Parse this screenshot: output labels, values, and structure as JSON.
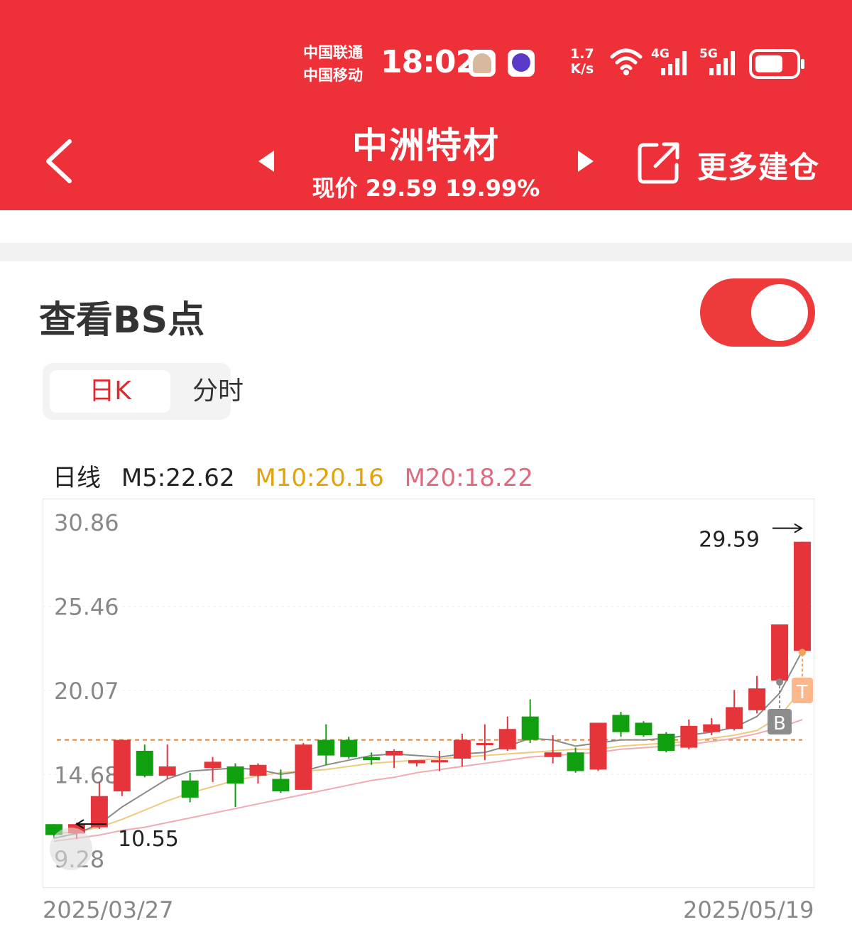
{
  "status_bar": {
    "carrier1": "中国联通",
    "carrier2": "中国移动",
    "time": "18:02",
    "speed_value": "1.7",
    "speed_unit": "K/s",
    "net1": "4G",
    "net2": "5G"
  },
  "header": {
    "title": "中洲特材",
    "subtitle": "现价 29.59 19.99%",
    "more_label": "更多建仓"
  },
  "bs_toggle": {
    "label": "查看BS点",
    "on": true
  },
  "segments": {
    "day_k": "日K",
    "intraday": "分时"
  },
  "ma_legend": {
    "label": "日线",
    "m5": "M5:22.62",
    "m10": "M10:20.16",
    "m20": "M20:18.22",
    "m5_color": "#222222",
    "m10_color": "#e3a10a",
    "m20_color": "#e06a7c"
  },
  "colors": {
    "brand_red": "#ee3039",
    "up": "#e5343a",
    "down": "#10a00f"
  },
  "chart_data": {
    "type": "candlestick",
    "y_ticks": [
      "30.86",
      "25.46",
      "20.07",
      "14.68",
      "9.28"
    ],
    "ylim": [
      9.28,
      30.86
    ],
    "high_label": "29.59",
    "low_label": "10.55",
    "date_start": "2025/03/27",
    "date_end": "2025/05/19",
    "reference_line": 16.9,
    "marker_buy": "B",
    "marker_sell": "T",
    "candles": [
      {
        "o": 11.5,
        "c": 10.8,
        "h": 11.5,
        "l": 10.6
      },
      {
        "o": 10.9,
        "c": 11.5,
        "h": 11.6,
        "l": 10.55
      },
      {
        "o": 11.3,
        "c": 13.3,
        "h": 14.2,
        "l": 11.2
      },
      {
        "o": 13.6,
        "c": 16.9,
        "h": 16.9,
        "l": 13.3
      },
      {
        "o": 16.2,
        "c": 14.6,
        "h": 16.6,
        "l": 14.5
      },
      {
        "o": 14.6,
        "c": 15.2,
        "h": 16.6,
        "l": 14.4
      },
      {
        "o": 14.3,
        "c": 13.2,
        "h": 14.8,
        "l": 12.9
      },
      {
        "o": 15.1,
        "c": 15.5,
        "h": 15.8,
        "l": 14.2
      },
      {
        "o": 15.2,
        "c": 14.1,
        "h": 15.4,
        "l": 12.6
      },
      {
        "o": 14.6,
        "c": 15.3,
        "h": 15.4,
        "l": 14.1
      },
      {
        "o": 14.4,
        "c": 13.6,
        "h": 15.0,
        "l": 13.5
      },
      {
        "o": 13.7,
        "c": 16.6,
        "h": 16.7,
        "l": 13.7
      },
      {
        "o": 16.9,
        "c": 15.9,
        "h": 17.9,
        "l": 15.3
      },
      {
        "o": 16.9,
        "c": 15.8,
        "h": 17.1,
        "l": 15.7
      },
      {
        "o": 15.8,
        "c": 15.6,
        "h": 16.1,
        "l": 15.3
      },
      {
        "o": 15.9,
        "c": 16.2,
        "h": 16.3,
        "l": 15.1
      },
      {
        "o": 15.4,
        "c": 15.6,
        "h": 15.6,
        "l": 15.2
      },
      {
        "o": 15.5,
        "c": 15.6,
        "h": 16.2,
        "l": 14.9
      },
      {
        "o": 15.7,
        "c": 16.9,
        "h": 17.3,
        "l": 15.2
      },
      {
        "o": 16.6,
        "c": 16.7,
        "h": 17.9,
        "l": 15.6
      },
      {
        "o": 16.3,
        "c": 17.6,
        "h": 18.4,
        "l": 16.2
      },
      {
        "o": 18.4,
        "c": 16.9,
        "h": 19.5,
        "l": 16.7
      },
      {
        "o": 15.8,
        "c": 16.1,
        "h": 17.2,
        "l": 15.4
      },
      {
        "o": 16.1,
        "c": 14.9,
        "h": 16.4,
        "l": 14.8
      },
      {
        "o": 15.0,
        "c": 18.0,
        "h": 18.0,
        "l": 14.9
      },
      {
        "o": 18.5,
        "c": 17.4,
        "h": 18.7,
        "l": 17.1
      },
      {
        "o": 18.0,
        "c": 17.2,
        "h": 18.1,
        "l": 17.1
      },
      {
        "o": 17.3,
        "c": 16.2,
        "h": 17.4,
        "l": 16.1
      },
      {
        "o": 16.4,
        "c": 17.8,
        "h": 18.2,
        "l": 16.3
      },
      {
        "o": 17.4,
        "c": 17.9,
        "h": 18.3,
        "l": 17.2
      },
      {
        "o": 17.6,
        "c": 19.0,
        "h": 20.1,
        "l": 17.5
      },
      {
        "o": 18.8,
        "c": 20.2,
        "h": 21.0,
        "l": 18.6
      },
      {
        "o": 20.7,
        "c": 24.3,
        "h": 24.3,
        "l": 20.7
      },
      {
        "o": 22.6,
        "c": 29.6,
        "h": 29.6,
        "l": 22.6
      }
    ],
    "ma5": [
      10.6,
      10.9,
      11.5,
      12.6,
      13.5,
      14.4,
      14.9,
      15.0,
      15.1,
      15.0,
      14.7,
      14.9,
      15.3,
      15.6,
      15.9,
      16.0,
      15.9,
      15.8,
      16.0,
      16.1,
      16.5,
      17.0,
      16.9,
      16.5,
      16.7,
      16.9,
      16.9,
      17.0,
      17.2,
      17.4,
      17.7,
      18.4,
      19.9,
      22.6
    ],
    "ma10": [
      10.9,
      11.0,
      11.3,
      11.8,
      12.4,
      13.0,
      13.5,
      13.9,
      14.3,
      14.6,
      14.8,
      14.9,
      15.0,
      15.2,
      15.4,
      15.5,
      15.6,
      15.7,
      15.8,
      15.9,
      16.0,
      16.1,
      16.2,
      16.3,
      16.3,
      16.5,
      16.6,
      16.7,
      16.8,
      17.0,
      17.2,
      17.5,
      18.4,
      20.2
    ],
    "ma20": [
      10.4,
      10.6,
      10.8,
      11.1,
      11.3,
      11.6,
      11.9,
      12.2,
      12.5,
      12.8,
      13.1,
      13.4,
      13.7,
      14.0,
      14.3,
      14.5,
      14.8,
      15.0,
      15.2,
      15.4,
      15.6,
      15.8,
      15.9,
      16.0,
      16.1,
      16.3,
      16.4,
      16.5,
      16.6,
      16.8,
      17.0,
      17.3,
      17.7,
      18.2
    ]
  }
}
